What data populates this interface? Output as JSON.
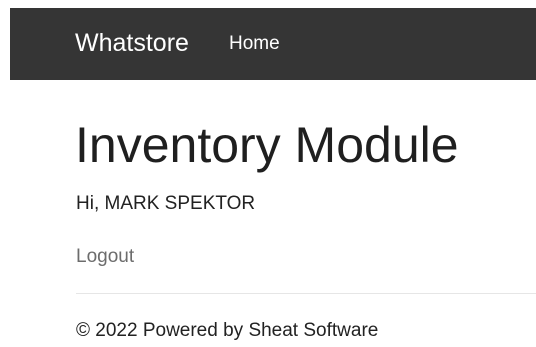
{
  "navbar": {
    "brand": "Whatstore",
    "links": [
      {
        "label": "Home"
      }
    ]
  },
  "main": {
    "title": "Inventory Module",
    "greeting": "Hi, MARK SPEKTOR",
    "logout_label": "Logout"
  },
  "footer": {
    "text": "© 2022 Powered by Sheat Software"
  },
  "colors": {
    "navbar_background": "#353535",
    "navbar_text": "#ffffff",
    "link_muted": "#6c6c6c"
  }
}
